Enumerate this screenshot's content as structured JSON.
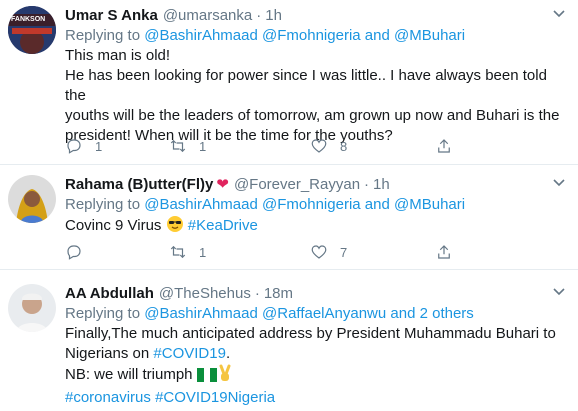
{
  "tweets": [
    {
      "name": "Umar S Anka",
      "handle": "@umarsanka",
      "time": "1h",
      "replying_prefix": "Replying to",
      "mentions": [
        "@BashirAhmaad",
        "@Fmohnigeria",
        "@MBuhari"
      ],
      "replying_and": "and",
      "lines": [
        "This man is old!",
        "He has been looking for power since I was little.. I have always been told the",
        "youths will be the leaders of tomorrow, am grown up now and Buhari is the",
        "president! When will it be the time for the youths?"
      ],
      "reply_count": "1",
      "retweet_count": "1",
      "like_count": "8",
      "avatar_text": "FANKSON"
    },
    {
      "name": "Rahama (B)utter(Fl)y",
      "handle": "@Forever_Rayyan",
      "time": "1h",
      "replying_prefix": "Replying to",
      "mentions": [
        "@BashirAhmaad",
        "@Fmohnigeria",
        "@MBuhari"
      ],
      "replying_and": "and",
      "text": "Covinc 9 Virus",
      "hashtag": "#KeaDrive",
      "reply_count": "",
      "retweet_count": "1",
      "like_count": "7"
    },
    {
      "name": "AA Abdullah",
      "handle": "@TheShehus",
      "time": "18m",
      "replying_prefix": "Replying to",
      "mentions": [
        "@BashirAhmaad",
        "@RaffaelAnyanwu"
      ],
      "replying_and": "and",
      "replying_others": "2 others",
      "line1": "Finally,The much anticipated address by President Muhammadu Buhari to",
      "line2_prefix": "Nigerians on",
      "line2_hashtag": "#COVID19",
      "line2_suffix": ".",
      "line3": "NB: we will triumph",
      "hashtags": [
        "#coronavirus",
        "#COVID19Nigeria"
      ]
    }
  ],
  "icons": {
    "reply": "reply-icon",
    "retweet": "retweet-icon",
    "like": "heart-icon",
    "more": "chevron-down-icon"
  },
  "colors": {
    "link": "#1b95e0",
    "muted": "#657786",
    "heart": "#e0245e",
    "border": "#e6ecf0"
  }
}
